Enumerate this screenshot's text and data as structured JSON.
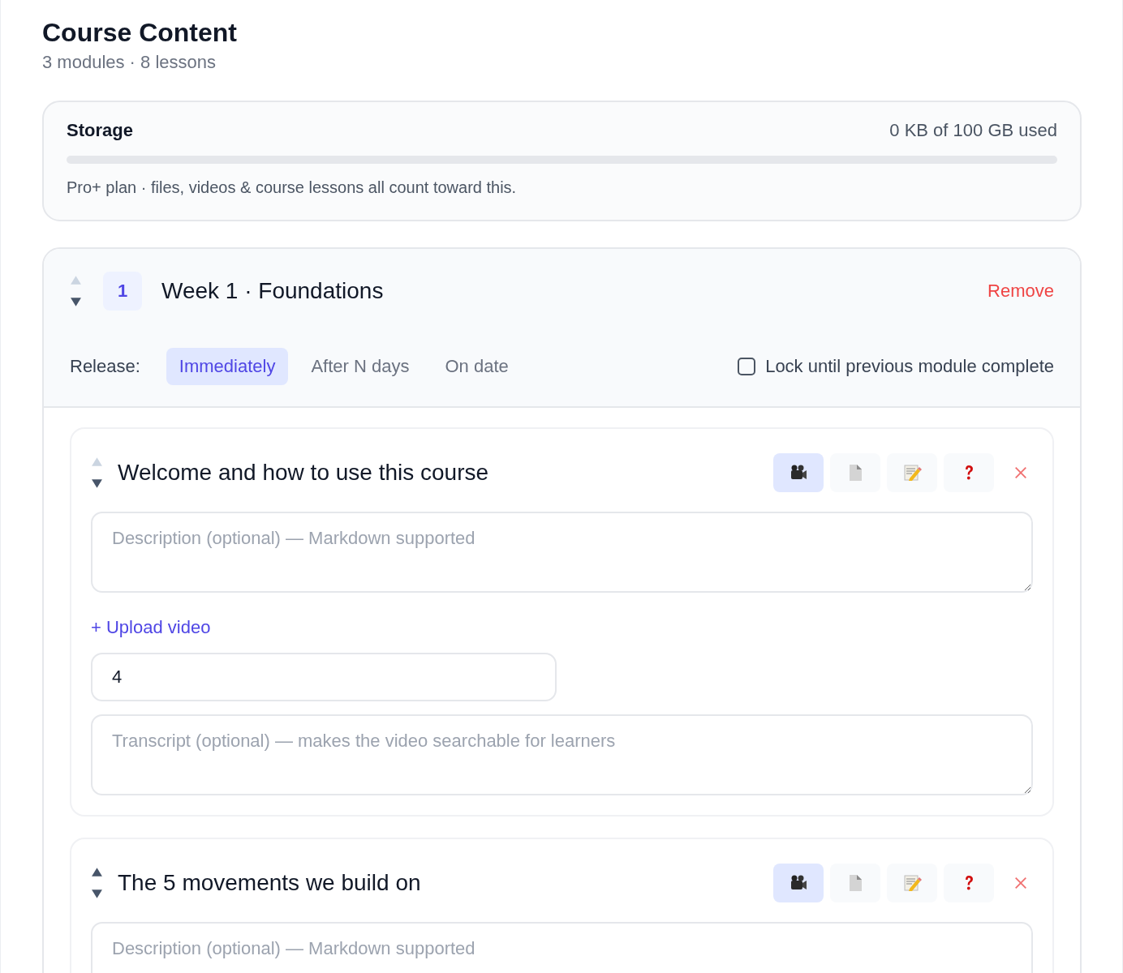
{
  "header": {
    "title": "Course Content",
    "subtitle": "3 modules · 8 lessons"
  },
  "storage": {
    "label": "Storage",
    "usage": "0 KB of 100 GB used",
    "level": 0,
    "note": "Pro+ plan · files, videos & course lessons all count toward this."
  },
  "modules": [
    {
      "number": "1",
      "title": "Week 1 · Foundations",
      "can_move_up": false,
      "can_move_down": true,
      "remove": "Remove",
      "release_label": "Release:",
      "release_options": [
        {
          "label": "Immediately",
          "selected": true
        },
        {
          "label": "After N days",
          "selected": false
        },
        {
          "label": "On date",
          "selected": false
        }
      ],
      "lock": {
        "label": "Lock until previous module complete",
        "checked": false
      },
      "lessons": [
        {
          "title": "Welcome and how to use this course",
          "can_move_up": false,
          "can_move_down": true,
          "types": [
            {
              "kind": "video",
              "selected": true
            },
            {
              "kind": "file",
              "selected": false
            },
            {
              "kind": "text",
              "selected": false
            },
            {
              "kind": "quiz",
              "selected": false
            }
          ],
          "description_placeholder": "Description (optional) — Markdown supported",
          "upload": "+ Upload video",
          "duration": "4",
          "transcript_placeholder": "Transcript (optional) — makes the video searchable for learners"
        },
        {
          "title": "The 5 movements we build on",
          "can_move_up": true,
          "can_move_down": true,
          "types": [
            {
              "kind": "video",
              "selected": true
            },
            {
              "kind": "file",
              "selected": false
            },
            {
              "kind": "text",
              "selected": false
            },
            {
              "kind": "quiz",
              "selected": false
            }
          ],
          "description_placeholder": "Description (optional) — Markdown supported"
        }
      ]
    }
  ]
}
